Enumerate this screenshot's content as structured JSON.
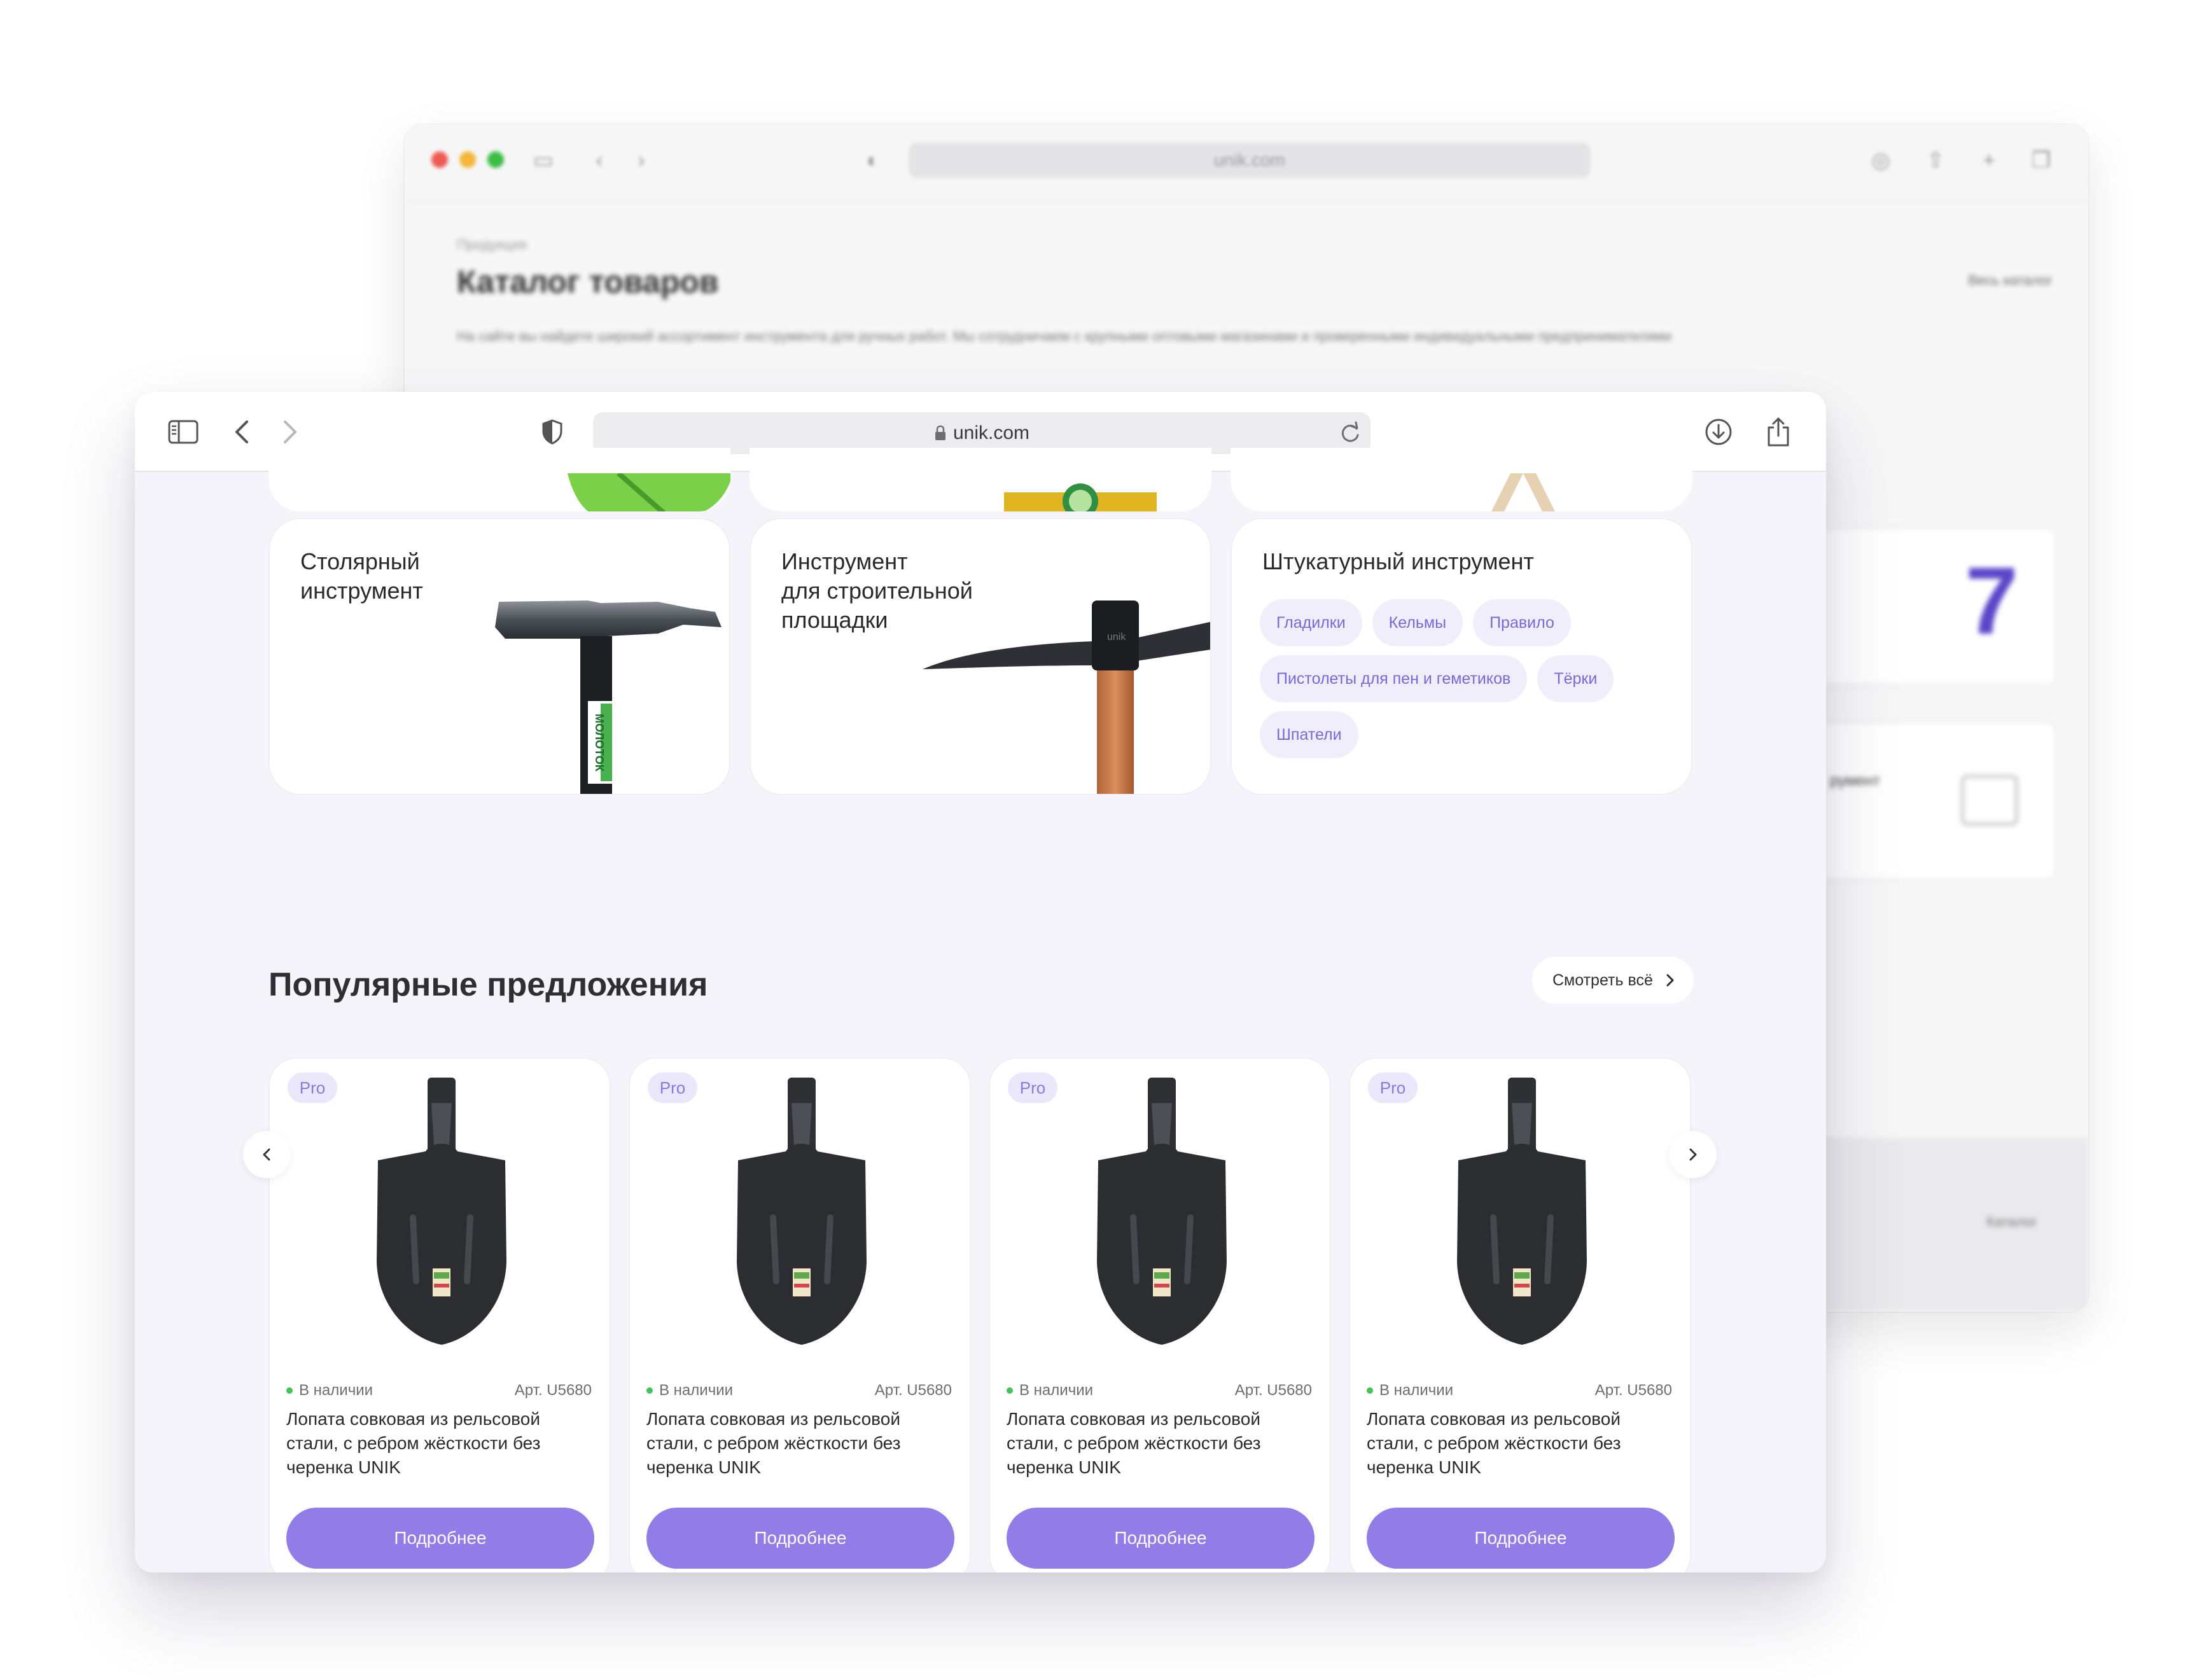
{
  "back_window": {
    "url": "unik.com",
    "breadcrumb": "Продукция",
    "title": "Каталог товаров",
    "all_catalog": "Весь каталог",
    "description": "На сайте вы найдете широкий ассортимент инструмента для ручных работ. Мы сотрудничаем с крупными оптовыми магазинами и проверенными индивидуальными предпринимателями",
    "tile_number": "7",
    "tile_label": "румент",
    "catalog_link": "Каталог"
  },
  "browser": {
    "url": "unik.com"
  },
  "categories": [
    {
      "title": "Столярный\nинструмент"
    },
    {
      "title": "Инструмент\nдля строительной\nплощадки"
    },
    {
      "title": "Штукатурный инструмент",
      "tags": [
        "Гладилки",
        "Кельмы",
        "Правило",
        "Пистолеты для пен и геметиков",
        "Тёрки",
        "Шпатели"
      ]
    }
  ],
  "hammer_label": "МОЛОТОК",
  "pick_brand": "unik",
  "popular": {
    "title": "Популярные предложения",
    "see_all": "Смотреть всё"
  },
  "products": [
    {
      "badge": "Pro",
      "stock": "В наличии",
      "article": "Арт. U5680",
      "name": "Лопата совковая из рельсовой стали, с ребром жёсткости без черенка UNIK",
      "button": "Подробнее"
    },
    {
      "badge": "Pro",
      "stock": "В наличии",
      "article": "Арт. U5680",
      "name": "Лопата совковая из рельсовой стали, с ребром жёсткости без черенка UNIK",
      "button": "Подробнее"
    },
    {
      "badge": "Pro",
      "stock": "В наличии",
      "article": "Арт. U5680",
      "name": "Лопата совковая из рельсовой стали, с ребром жёсткости без черенка UNIK",
      "button": "Подробнее"
    },
    {
      "badge": "Pro",
      "stock": "В наличии",
      "article": "Арт. U5680",
      "name": "Лопата совковая из рельсовой стали, с ребром жёсткости без черенка UNIK",
      "button": "Подробнее"
    }
  ],
  "colors": {
    "accent": "#917ce8",
    "tag_bg": "#f1eefb",
    "tag_text": "#7b68d8",
    "in_stock": "#44c25a",
    "page_bg": "#f5f4fa"
  }
}
